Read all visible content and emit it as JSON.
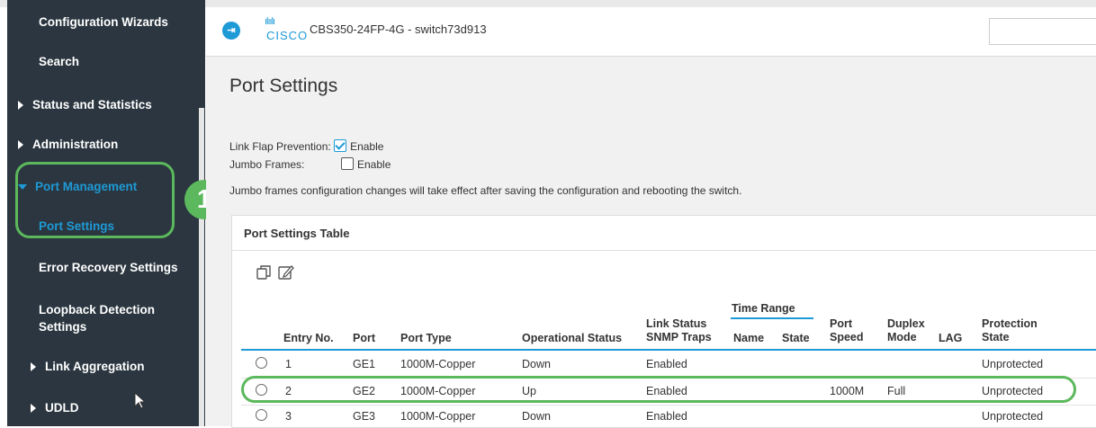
{
  "header": {
    "device": "CBS350-24FP-4G - switch73d913",
    "cisco_bars": "ılıılı",
    "cisco_word": "CISCO",
    "badge_number": "1"
  },
  "sidebar": {
    "config_wizards": "Configuration Wizards",
    "search": "Search",
    "status_stats": "Status and Statistics",
    "administration": "Administration",
    "port_management": "Port Management",
    "port_settings": "Port Settings",
    "error_recovery": "Error Recovery Settings",
    "loopback_1": "Loopback Detection",
    "loopback_2": "Settings",
    "link_aggregation": "Link Aggregation",
    "udld": "UDLD"
  },
  "page": {
    "title": "Port Settings",
    "link_flap_label": "Link Flap Prevention:",
    "link_flap_enable": "Enable",
    "link_flap_checked": true,
    "jumbo_label": "Jumbo Frames:",
    "jumbo_enable": "Enable",
    "jumbo_checked": false,
    "note": "Jumbo frames configuration changes will take effect after saving the configuration and rebooting the switch."
  },
  "table": {
    "title": "Port Settings Table",
    "headers": {
      "entry": "Entry No.",
      "port": "Port",
      "port_type": "Port Type",
      "op_status": "Operational Status",
      "link_status_1": "Link Status",
      "link_status_2": "SNMP Traps",
      "time_range": "Time Range",
      "name": "Name",
      "state": "State",
      "port_speed_1": "Port",
      "port_speed_2": "Speed",
      "duplex_1": "Duplex",
      "duplex_2": "Mode",
      "lag": "LAG",
      "protection_1": "Protection",
      "protection_2": "State"
    },
    "rows": [
      {
        "entry": "1",
        "port": "GE1",
        "type": "1000M-Copper",
        "status": "Down",
        "traps": "Enabled",
        "speed": "",
        "duplex": "",
        "protection": "Unprotected"
      },
      {
        "entry": "2",
        "port": "GE2",
        "type": "1000M-Copper",
        "status": "Up",
        "traps": "Enabled",
        "speed": "1000M",
        "duplex": "Full",
        "protection": "Unprotected"
      },
      {
        "entry": "3",
        "port": "GE3",
        "type": "1000M-Copper",
        "status": "Down",
        "traps": "Enabled",
        "speed": "",
        "duplex": "",
        "protection": "Unprotected"
      }
    ]
  },
  "colors": {
    "accent": "#1e9ad6",
    "highlight": "#5cb85c",
    "sidebar_bg": "#2b3640"
  }
}
